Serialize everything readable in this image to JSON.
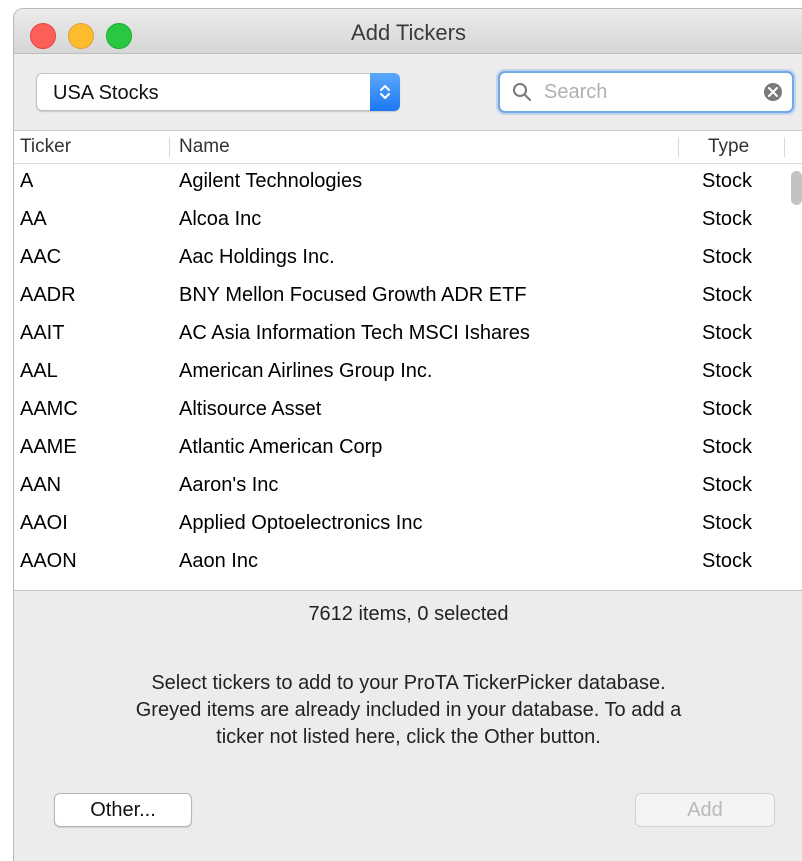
{
  "window": {
    "title": "Add Tickers"
  },
  "toolbar": {
    "market_select": "USA Stocks",
    "search_placeholder": "Search"
  },
  "table": {
    "columns": [
      "Ticker",
      "Name",
      "Type"
    ],
    "rows": [
      {
        "ticker": "A",
        "name": "Agilent Technologies",
        "type": "Stock"
      },
      {
        "ticker": "AA",
        "name": "Alcoa Inc",
        "type": "Stock"
      },
      {
        "ticker": "AAC",
        "name": "Aac Holdings Inc.",
        "type": "Stock"
      },
      {
        "ticker": "AADR",
        "name": "BNY Mellon Focused Growth ADR ETF",
        "type": "Stock"
      },
      {
        "ticker": "AAIT",
        "name": "AC Asia Information Tech MSCI Ishares",
        "type": "Stock"
      },
      {
        "ticker": "AAL",
        "name": "American Airlines Group Inc.",
        "type": "Stock"
      },
      {
        "ticker": "AAMC",
        "name": "Altisource Asset",
        "type": "Stock"
      },
      {
        "ticker": "AAME",
        "name": "Atlantic American Corp",
        "type": "Stock"
      },
      {
        "ticker": "AAN",
        "name": "Aaron's Inc",
        "type": "Stock"
      },
      {
        "ticker": "AAOI",
        "name": "Applied Optoelectronics Inc",
        "type": "Stock"
      },
      {
        "ticker": "AAON",
        "name": "Aaon Inc",
        "type": "Stock"
      }
    ]
  },
  "status": "7612 items, 0 selected",
  "info_lines": [
    "Select tickers to add to your ProTA TickerPicker database.",
    "Greyed items are already included in your database.  To add a",
    "ticker not listed here, click the Other button."
  ],
  "buttons": {
    "other": "Other...",
    "add": "Add"
  },
  "colors": {
    "close": "#fc5f57",
    "minimize": "#fdbc2e",
    "zoom": "#28c940",
    "accent": "#1b78f2"
  }
}
